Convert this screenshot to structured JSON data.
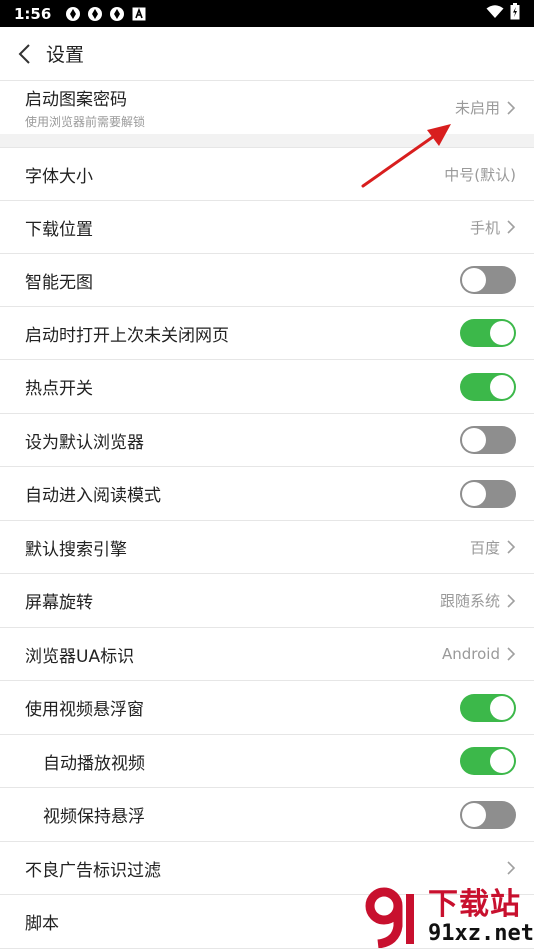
{
  "status_bar": {
    "time": "1:56"
  },
  "header": {
    "title": "设置"
  },
  "rows": [
    {
      "label": "启动图案密码",
      "sub": "使用浏览器前需要解锁",
      "value": "未启用",
      "chevron": true
    },
    {
      "label": "字体大小",
      "value": "中号(默认)",
      "chevron": false
    },
    {
      "label": "下载位置",
      "value": "手机",
      "chevron": true
    },
    {
      "label": "智能无图",
      "toggle": "off"
    },
    {
      "label": "启动时打开上次未关闭网页",
      "toggle": "on"
    },
    {
      "label": "热点开关",
      "toggle": "on"
    },
    {
      "label": "设为默认浏览器",
      "toggle": "off"
    },
    {
      "label": "自动进入阅读模式",
      "toggle": "off"
    },
    {
      "label": "默认搜索引擎",
      "value": "百度",
      "chevron": true
    },
    {
      "label": "屏幕旋转",
      "value": "跟随系统",
      "chevron": true
    },
    {
      "label": "浏览器UA标识",
      "value": "Android",
      "chevron": true
    },
    {
      "label": "使用视频悬浮窗",
      "toggle": "on"
    },
    {
      "label": "自动播放视频",
      "toggle": "on"
    },
    {
      "label": "视频保持悬浮",
      "toggle": "off"
    },
    {
      "label": "不良广告标识过滤",
      "value": "",
      "chevron": true
    },
    {
      "label": "脚本"
    }
  ],
  "watermark": {
    "title": "下载站",
    "domain": "91xz.net"
  },
  "colors": {
    "toggle_on": "#3cb84a",
    "toggle_off": "#8e8e8e",
    "annotation_arrow": "#d81e1e",
    "watermark_red": "#c8102e"
  }
}
